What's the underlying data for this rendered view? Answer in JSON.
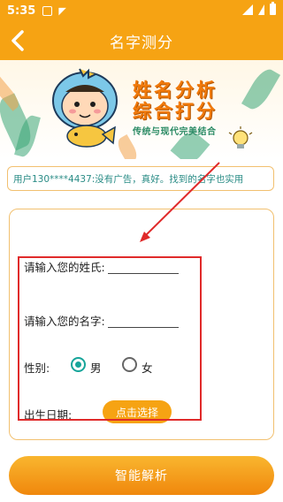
{
  "status_bar": {
    "time": "5:35",
    "icons": [
      "square-icon",
      "sd-card-icon",
      "wifi-icon",
      "signal-icon",
      "battery-icon"
    ]
  },
  "app_bar": {
    "title": "名字测分",
    "back_icon": "chevron-left-icon"
  },
  "banner": {
    "line1": "姓名分析",
    "line2": "综合打分",
    "line3": "传统与现代完美结合"
  },
  "ticker": {
    "text": "用户130****4437:没有广告，真好。找到的名字也实用"
  },
  "form": {
    "surname_label": "请输入您的姓氏:",
    "surname_value": "",
    "name_label": "请输入您的名字:",
    "name_value": "",
    "gender_label": "性别:",
    "gender_options": [
      {
        "label": "男",
        "selected": true
      },
      {
        "label": "女",
        "selected": false
      }
    ],
    "birthdate_label": "出生日期:",
    "birthdate_button": "点击选择"
  },
  "action": {
    "analyze_button": "智能解析"
  },
  "colors": {
    "primary": "#f6a313",
    "accent_teal": "#17a59a",
    "highlight_red": "#e02a2a",
    "ticker_text": "#2a8c86"
  }
}
